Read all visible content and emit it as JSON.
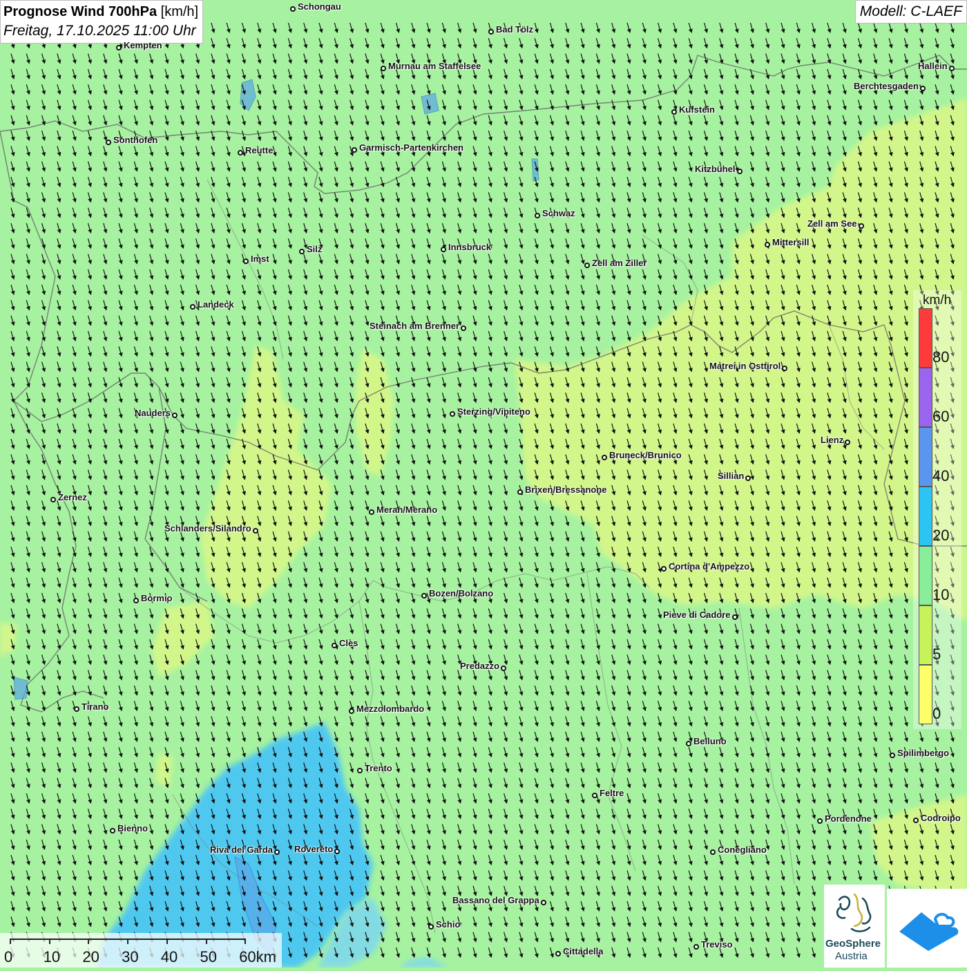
{
  "title": {
    "main_bold": "Prognose Wind 700hPa",
    "main_unit": " [km/h]",
    "subtitle": "Freitag, 17.10.2025 11:00 Uhr"
  },
  "model": "Modell: C-LAEF",
  "legend": {
    "unit": "km/h",
    "ticks": [
      "80",
      "60",
      "40",
      "20",
      "10",
      "5",
      "0"
    ],
    "colors": [
      "#ff3a3a",
      "#9a64ee",
      "#5a96f0",
      "#2cc4f2",
      "#88ee9a",
      "#c8f25a",
      "#ffff6a"
    ]
  },
  "scale": {
    "labels": [
      "0",
      "10",
      "20",
      "30",
      "40",
      "50",
      "60km"
    ]
  },
  "logos": {
    "geosphere_line1": "GeoSphere",
    "geosphere_line2": "Austria",
    "geosphere_icon": "geosphere-logo-icon",
    "weather_icon": "mountain-cloud-logo-icon"
  },
  "wind": {
    "direction": "from north-northwest",
    "arrow_icon": "wind-arrow-icon"
  },
  "cities": [
    {
      "name": "Schongau",
      "label_side": "right"
    },
    {
      "name": "Bad Tölz",
      "label_side": "right"
    },
    {
      "name": "Kempten",
      "label_side": "right"
    },
    {
      "name": "Murnau am Staffelsee",
      "label_side": "right"
    },
    {
      "name": "Hallein",
      "label_side": "left"
    },
    {
      "name": "Berchtesgaden",
      "label_side": "left"
    },
    {
      "name": "Kufstein",
      "label_side": "right"
    },
    {
      "name": "Sonthofen",
      "label_side": "right"
    },
    {
      "name": "Reutte",
      "label_side": "right"
    },
    {
      "name": "Garmisch-Partenkirchen",
      "label_side": "right"
    },
    {
      "name": "Kitzbühel",
      "label_side": "left"
    },
    {
      "name": "Schwaz",
      "label_side": "right"
    },
    {
      "name": "Zell am See",
      "label_side": "left"
    },
    {
      "name": "Mittersill",
      "label_side": "right"
    },
    {
      "name": "Innsbruck",
      "label_side": "right"
    },
    {
      "name": "Silz",
      "label_side": "right"
    },
    {
      "name": "Imst",
      "label_side": "right"
    },
    {
      "name": "Zell am Ziller",
      "label_side": "right"
    },
    {
      "name": "Landeck",
      "label_side": "right"
    },
    {
      "name": "Steinach am Brenner",
      "label_side": "left"
    },
    {
      "name": "Matrei in Osttirol",
      "label_side": "left"
    },
    {
      "name": "Nauders",
      "label_side": "left"
    },
    {
      "name": "Sterzing/Vipiteno",
      "label_side": "right"
    },
    {
      "name": "Lienz",
      "label_side": "left"
    },
    {
      "name": "Bruneck/Brunico",
      "label_side": "right"
    },
    {
      "name": "Sillian",
      "label_side": "left"
    },
    {
      "name": "Brixen/Bressanone",
      "label_side": "right"
    },
    {
      "name": "Zernez",
      "label_side": "right"
    },
    {
      "name": "Meran/Merano",
      "label_side": "right"
    },
    {
      "name": "Schlanders/Silandro",
      "label_side": "left"
    },
    {
      "name": "Cortina d'Ampezzo",
      "label_side": "right"
    },
    {
      "name": "Bozen/Bolzano",
      "label_side": "right"
    },
    {
      "name": "Bormio",
      "label_side": "right"
    },
    {
      "name": "Pieve di Cadore",
      "label_side": "left"
    },
    {
      "name": "Cles",
      "label_side": "right"
    },
    {
      "name": "Predazzo",
      "label_side": "left"
    },
    {
      "name": "Tirano",
      "label_side": "right"
    },
    {
      "name": "Mezzolombardo",
      "label_side": "right"
    },
    {
      "name": "Belluno",
      "label_side": "right"
    },
    {
      "name": "Spilimbergo",
      "label_side": "right"
    },
    {
      "name": "Trento",
      "label_side": "right"
    },
    {
      "name": "Feltre",
      "label_side": "right"
    },
    {
      "name": "Bienno",
      "label_side": "right"
    },
    {
      "name": "Pordenone",
      "label_side": "right"
    },
    {
      "name": "Codroipo",
      "label_side": "right"
    },
    {
      "name": "Riva del Garda",
      "label_side": "left"
    },
    {
      "name": "Rovereto",
      "label_side": "left"
    },
    {
      "name": "Conegliano",
      "label_side": "right"
    },
    {
      "name": "Bassano del Grappa",
      "label_side": "left"
    },
    {
      "name": "Schio",
      "label_side": "right"
    },
    {
      "name": "Treviso",
      "label_side": "right"
    },
    {
      "name": "Cittadella",
      "label_side": "right"
    }
  ]
}
